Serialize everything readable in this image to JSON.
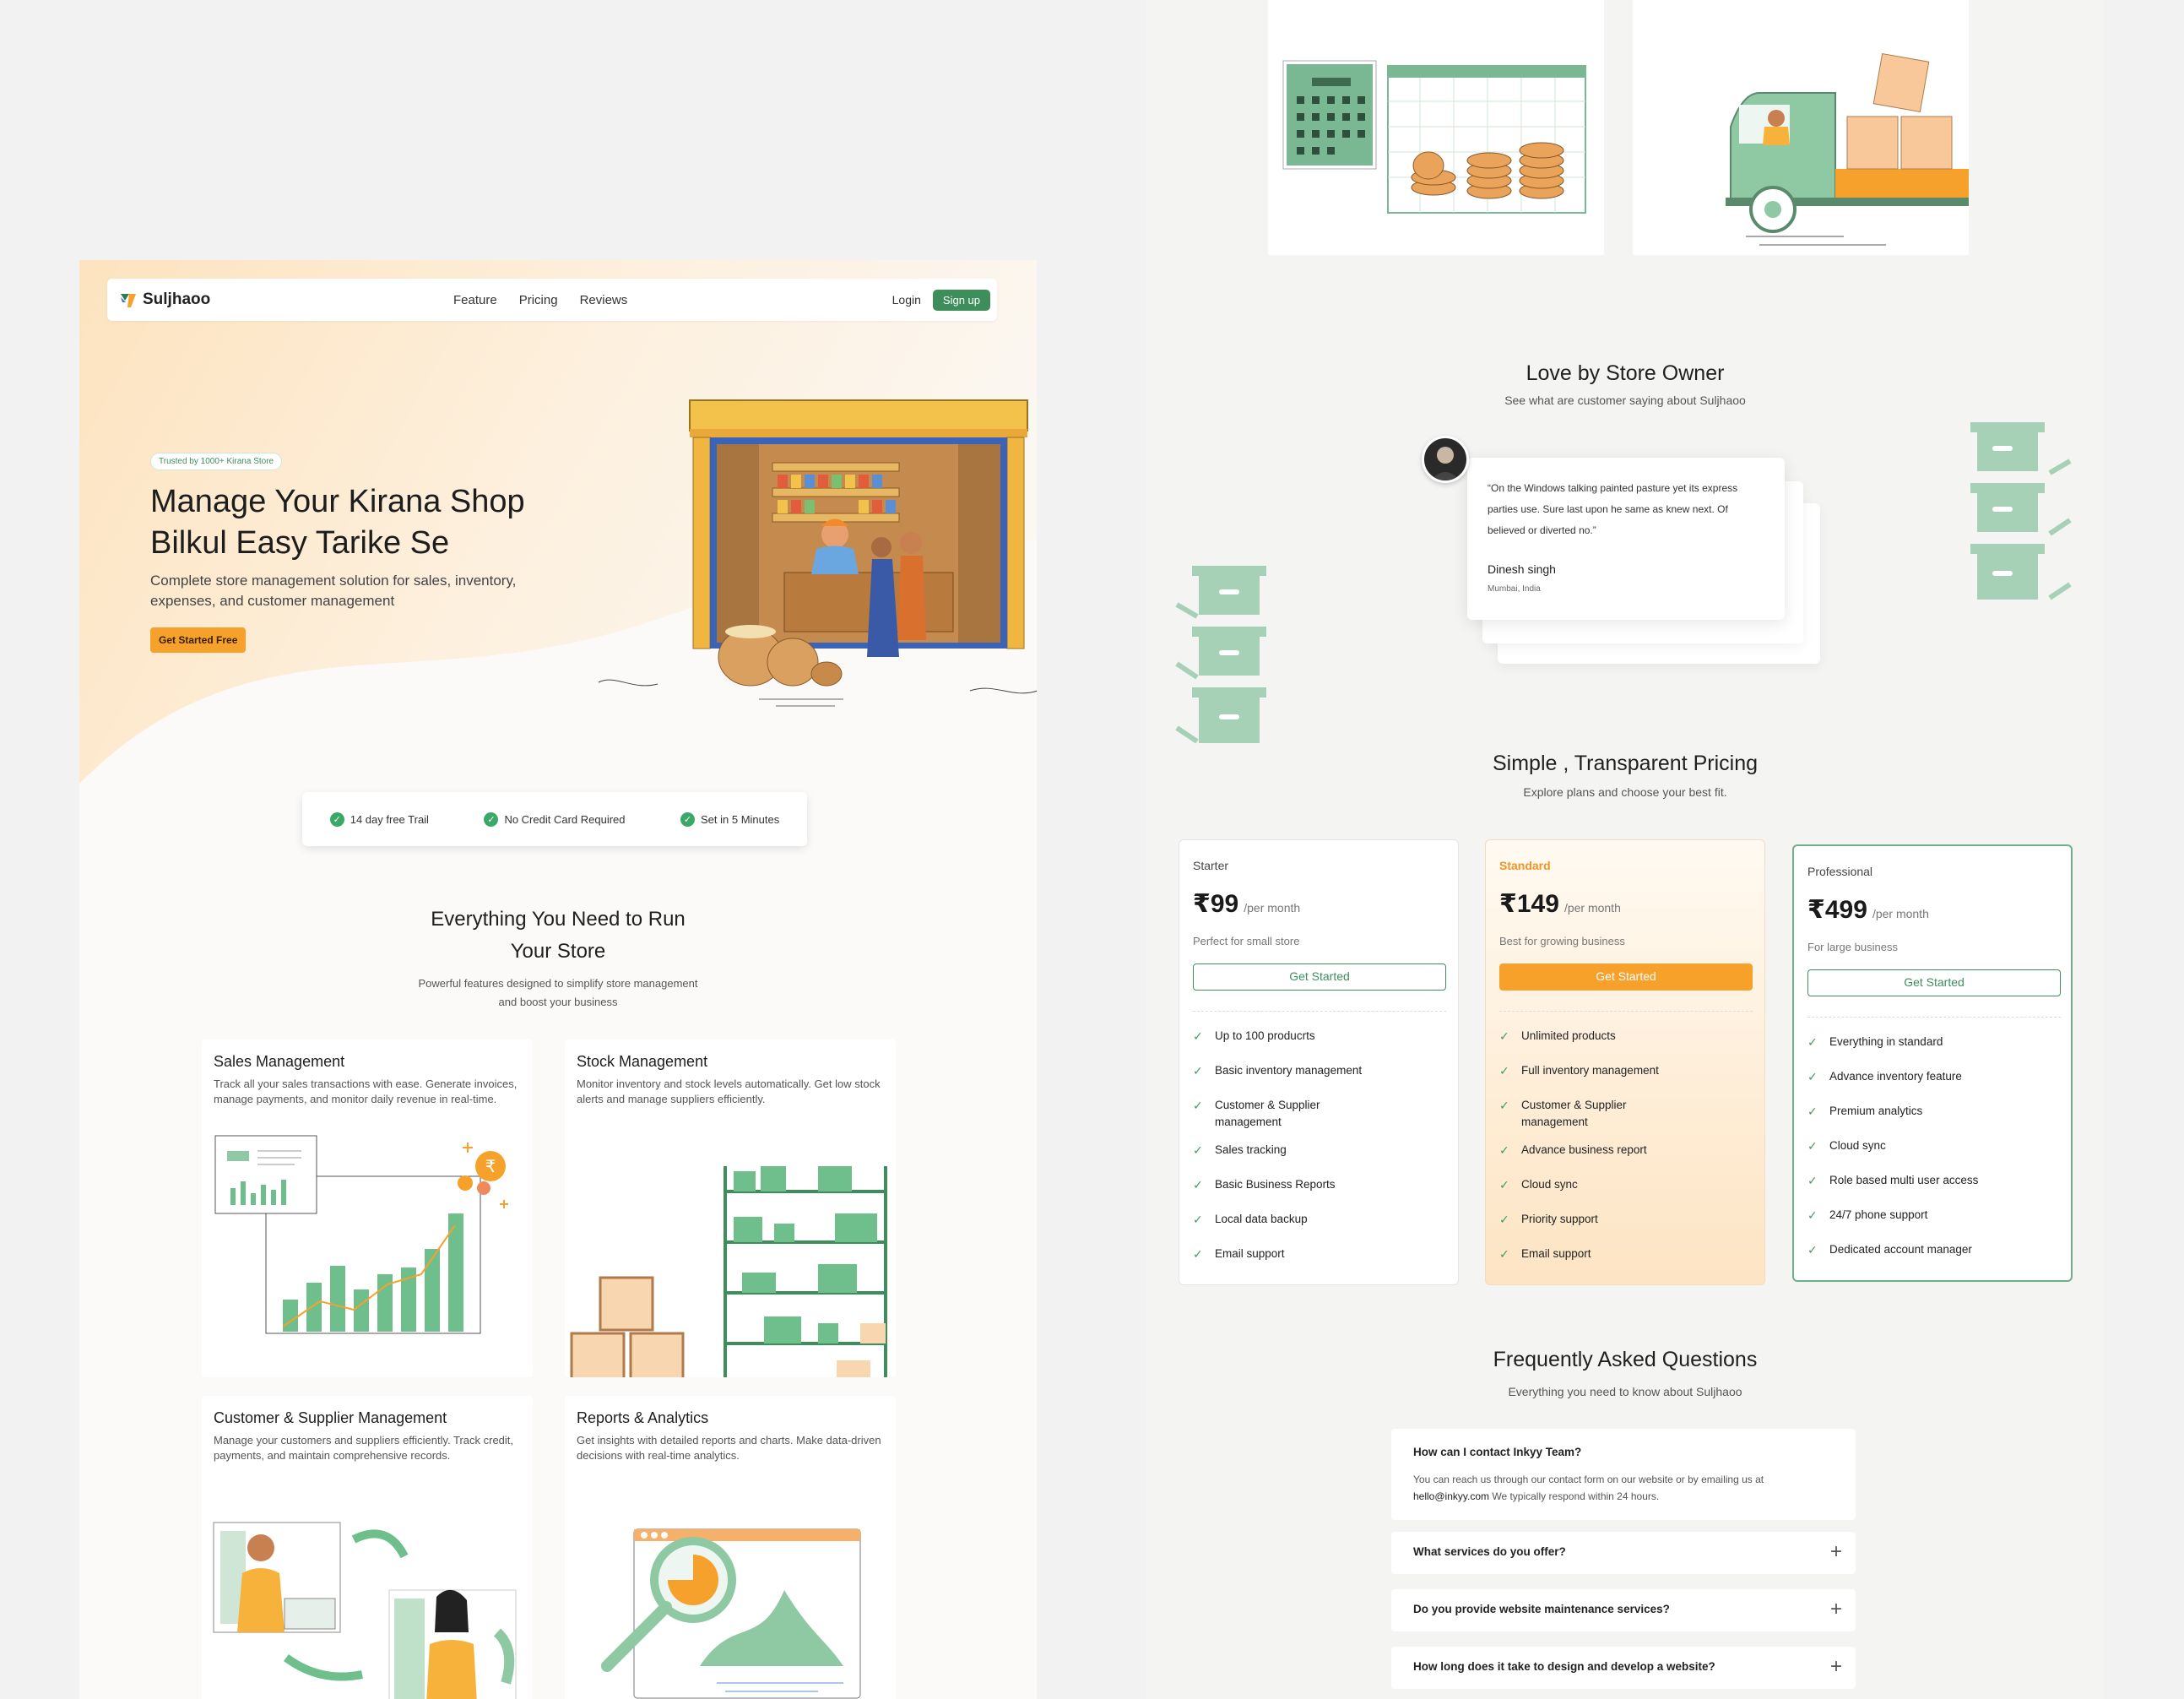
{
  "nav": {
    "brand": "Suljhaoo",
    "links": [
      "Feature",
      "Pricing",
      "Reviews"
    ],
    "login": "Login",
    "signup": "Sign up"
  },
  "hero": {
    "badge": "Trusted by 1000+ Kirana Store",
    "title_line1": "Manage Your Kirana Shop",
    "title_line2": "Bilkul Easy Tarike Se",
    "subtitle": "Complete store management solution for sales, inventory, expenses, and customer management",
    "cta": "Get Started Free"
  },
  "perks": [
    "14 day free Trail",
    "No Credit Card Required",
    "Set in 5 Minutes"
  ],
  "features": {
    "title_line1": "Everything You Need to Run",
    "title_line2": "Your Store",
    "subtitle_line1": "Powerful features designed to simplify store management",
    "subtitle_line2": "and boost your business",
    "cards": [
      {
        "title": "Sales Management",
        "desc": "Track all your sales transactions with ease. Generate invoices, manage payments, and monitor daily revenue in real-time."
      },
      {
        "title": "Stock Management",
        "desc": "Monitor inventory and stock levels automatically. Get low stock alerts and manage suppliers efficiently."
      },
      {
        "title": "Customer & Supplier Management",
        "desc": "Manage your customers and suppliers efficiently. Track credit, payments, and maintain comprehensive records."
      },
      {
        "title": "Reports & Analytics",
        "desc": "Get insights with detailed reports and charts. Make data-driven decisions with real-time analytics."
      }
    ]
  },
  "testimonials": {
    "title": "Love by Store Owner",
    "subtitle": "See what are customer saying about Suljhaoo",
    "quote": "“On the Windows talking painted pasture yet its express parties use. Sure last upon he same as knew next. Of believed or diverted no.”",
    "name": "Dinesh singh",
    "location": "Mumbai, India"
  },
  "pricing": {
    "title": "Simple , Transparent Pricing",
    "subtitle": "Explore plans and choose your best fit.",
    "plans": [
      {
        "name": "Starter",
        "price": "₹99",
        "per": "/per month",
        "desc": "Perfect for small store",
        "cta": "Get Started",
        "features": [
          "Up to 100 producrts",
          "Basic inventory management",
          "Customer & Supplier management",
          "Sales tracking",
          "Basic Business Reports",
          "Local data backup",
          "Email support"
        ]
      },
      {
        "name": "Standard",
        "price": "₹149",
        "per": "/per month",
        "desc": "Best for growing business",
        "cta": "Get Started",
        "features": [
          "Unlimited products",
          "Full inventory management",
          "Customer & Supplier management",
          "Advance business report",
          "Cloud sync",
          "Priority support",
          "Email support"
        ]
      },
      {
        "name": "Professional",
        "price": "₹499",
        "per": "/per month",
        "desc": "For large business",
        "cta": "Get Started",
        "features": [
          "Everything in standard",
          "Advance inventory feature",
          "Premium analytics",
          "Cloud sync",
          "Role based multi user access",
          "24/7 phone support",
          "Dedicated account manager"
        ]
      }
    ]
  },
  "faq": {
    "title": "Frequently Asked Questions",
    "subtitle": "Everything you need to know about Suljhaoo",
    "open": {
      "q": "How can I contact Inkyy Team?",
      "a1": "You can reach us through our contact form on our website or by emailing us at",
      "email": "hello@inkyy.com",
      "a2": " We typically respond within 24 hours."
    },
    "items": [
      "What services do you offer?",
      "Do you provide website maintenance services?",
      "How long does it take to design and develop a website?"
    ]
  },
  "colors": {
    "accent": "#3e8e5c",
    "orange": "#f6a12b",
    "mint": "#8ec9a3"
  }
}
